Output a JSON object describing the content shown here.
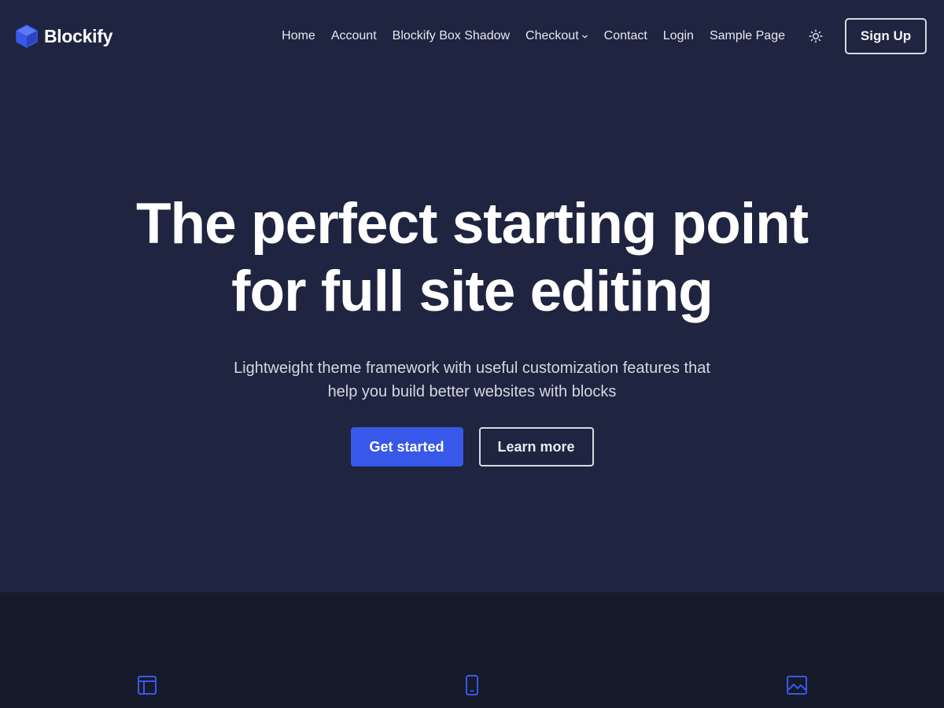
{
  "header": {
    "brand_name": "Blockify",
    "nav": [
      {
        "label": "Home"
      },
      {
        "label": "Account"
      },
      {
        "label": "Blockify Box Shadow"
      },
      {
        "label": "Checkout",
        "has_dropdown": true
      },
      {
        "label": "Contact"
      },
      {
        "label": "Login"
      },
      {
        "label": "Sample Page"
      }
    ],
    "theme_toggle_icon": "sun-icon",
    "signup_label": "Sign Up"
  },
  "hero": {
    "title_line1": "The perfect starting point",
    "title_line2": "for full site editing",
    "subtitle_line1": "Lightweight theme framework with useful customization features that",
    "subtitle_line2": "help you build better websites with blocks",
    "primary_cta": "Get started",
    "secondary_cta": "Learn more"
  },
  "features": {
    "icons": [
      "layout-icon",
      "mobile-icon",
      "image-icon"
    ]
  },
  "colors": {
    "hero_bg": "#1f2440",
    "features_bg": "#161b2b",
    "accent": "#3858e9",
    "text": "#ffffff"
  }
}
